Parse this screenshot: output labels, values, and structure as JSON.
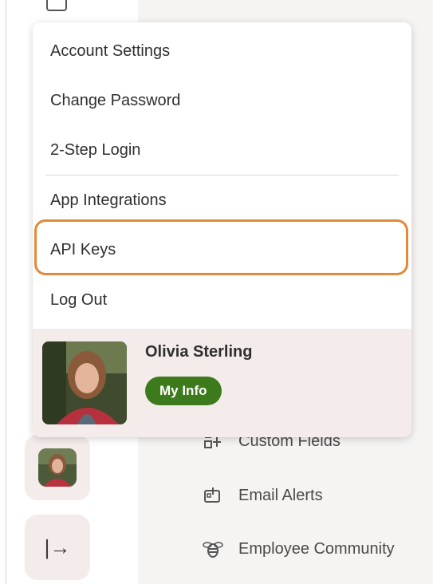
{
  "menu": {
    "items": [
      {
        "label": "Account Settings"
      },
      {
        "label": "Change Password"
      },
      {
        "label": "2-Step Login"
      },
      {
        "label": "App Integrations"
      },
      {
        "label": "API Keys"
      },
      {
        "label": "Log Out"
      }
    ],
    "highlighted_item": "API Keys",
    "highlight_color": "#e2893a"
  },
  "profile": {
    "name": "Olivia Sterling",
    "my_info_label": "My Info",
    "my_info_color": "#3c7a1b"
  },
  "settings_list": {
    "items": [
      {
        "label": "Custom Fields",
        "icon": "custom-fields-icon"
      },
      {
        "label": "Email Alerts",
        "icon": "email-alerts-icon"
      },
      {
        "label": "Employee Community",
        "icon": "bee-icon"
      }
    ]
  },
  "rail": {
    "icons": [
      "avatar",
      "exit-arrow-icon"
    ]
  }
}
